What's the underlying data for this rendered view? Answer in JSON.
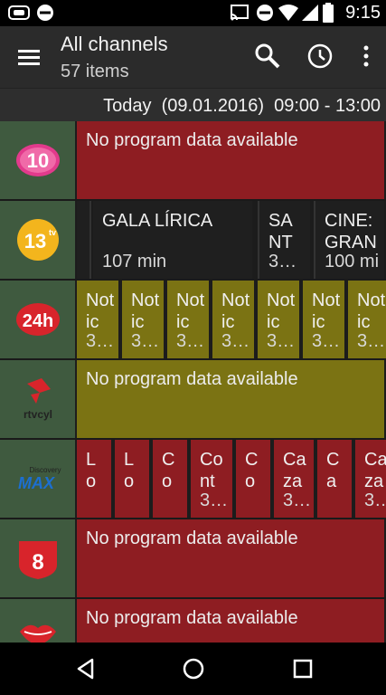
{
  "status_bar": {
    "time": "9:15",
    "icons": [
      "nfc-icon",
      "do-not-disturb-icon",
      "cast-icon",
      "do-not-disturb-icon",
      "wifi-icon",
      "signal-icon",
      "battery-icon"
    ]
  },
  "app_bar": {
    "title": "All channels",
    "subtitle": "57 items",
    "actions": [
      "menu-icon",
      "search-icon",
      "history-icon",
      "more-vert-icon"
    ]
  },
  "time_header": "Today  (09.01.2016)  09:00 - 13:00",
  "channels": [
    {
      "logo": "10",
      "programs": [
        {
          "title": "No program data available",
          "duration": ""
        }
      ]
    },
    {
      "logo": "13tv",
      "programs": [
        {
          "title": "",
          "duration": ""
        },
        {
          "title": "GALA LÍRICA",
          "duration": "107 min"
        },
        {
          "title": "SANT",
          "duration": "3…"
        },
        {
          "title": "CINE: GRAN",
          "duration": "100 mi"
        }
      ]
    },
    {
      "logo": "24h",
      "programs": [
        {
          "title": "Notic",
          "duration": "3…"
        },
        {
          "title": "Notic",
          "duration": "3…"
        },
        {
          "title": "Notic",
          "duration": "3…"
        },
        {
          "title": "Notic",
          "duration": "3…"
        },
        {
          "title": "Notic",
          "duration": "3…"
        },
        {
          "title": "Notic",
          "duration": "3…"
        },
        {
          "title": "Notic",
          "duration": "3…"
        }
      ]
    },
    {
      "logo": "rtvcyl",
      "programs": [
        {
          "title": "No program data available",
          "duration": ""
        }
      ]
    },
    {
      "logo": "Discovery MAX",
      "programs": [
        {
          "title": "Lo",
          "duration": ""
        },
        {
          "title": "Lo",
          "duration": ""
        },
        {
          "title": "Co",
          "duration": ""
        },
        {
          "title": "Cont",
          "duration": "3…"
        },
        {
          "title": "Co",
          "duration": ""
        },
        {
          "title": "Caza",
          "duration": "3…"
        },
        {
          "title": "Ca",
          "duration": ""
        },
        {
          "title": "Caza",
          "duration": "3…"
        }
      ]
    },
    {
      "logo": "8",
      "programs": [
        {
          "title": "No program data available",
          "duration": ""
        }
      ]
    },
    {
      "logo": "lips",
      "programs": [
        {
          "title": "No program data available",
          "duration": ""
        }
      ]
    }
  ],
  "colors": {
    "no_data": "#8e1d22",
    "program_red": "#8e1d22",
    "program_olive": "#7b7313",
    "program_dark": "#1f1f1f",
    "logo_bg": "#3f5a3f",
    "app_bar": "#2b2b2b"
  },
  "nav_bar": [
    "back-icon",
    "home-icon",
    "recents-icon"
  ]
}
